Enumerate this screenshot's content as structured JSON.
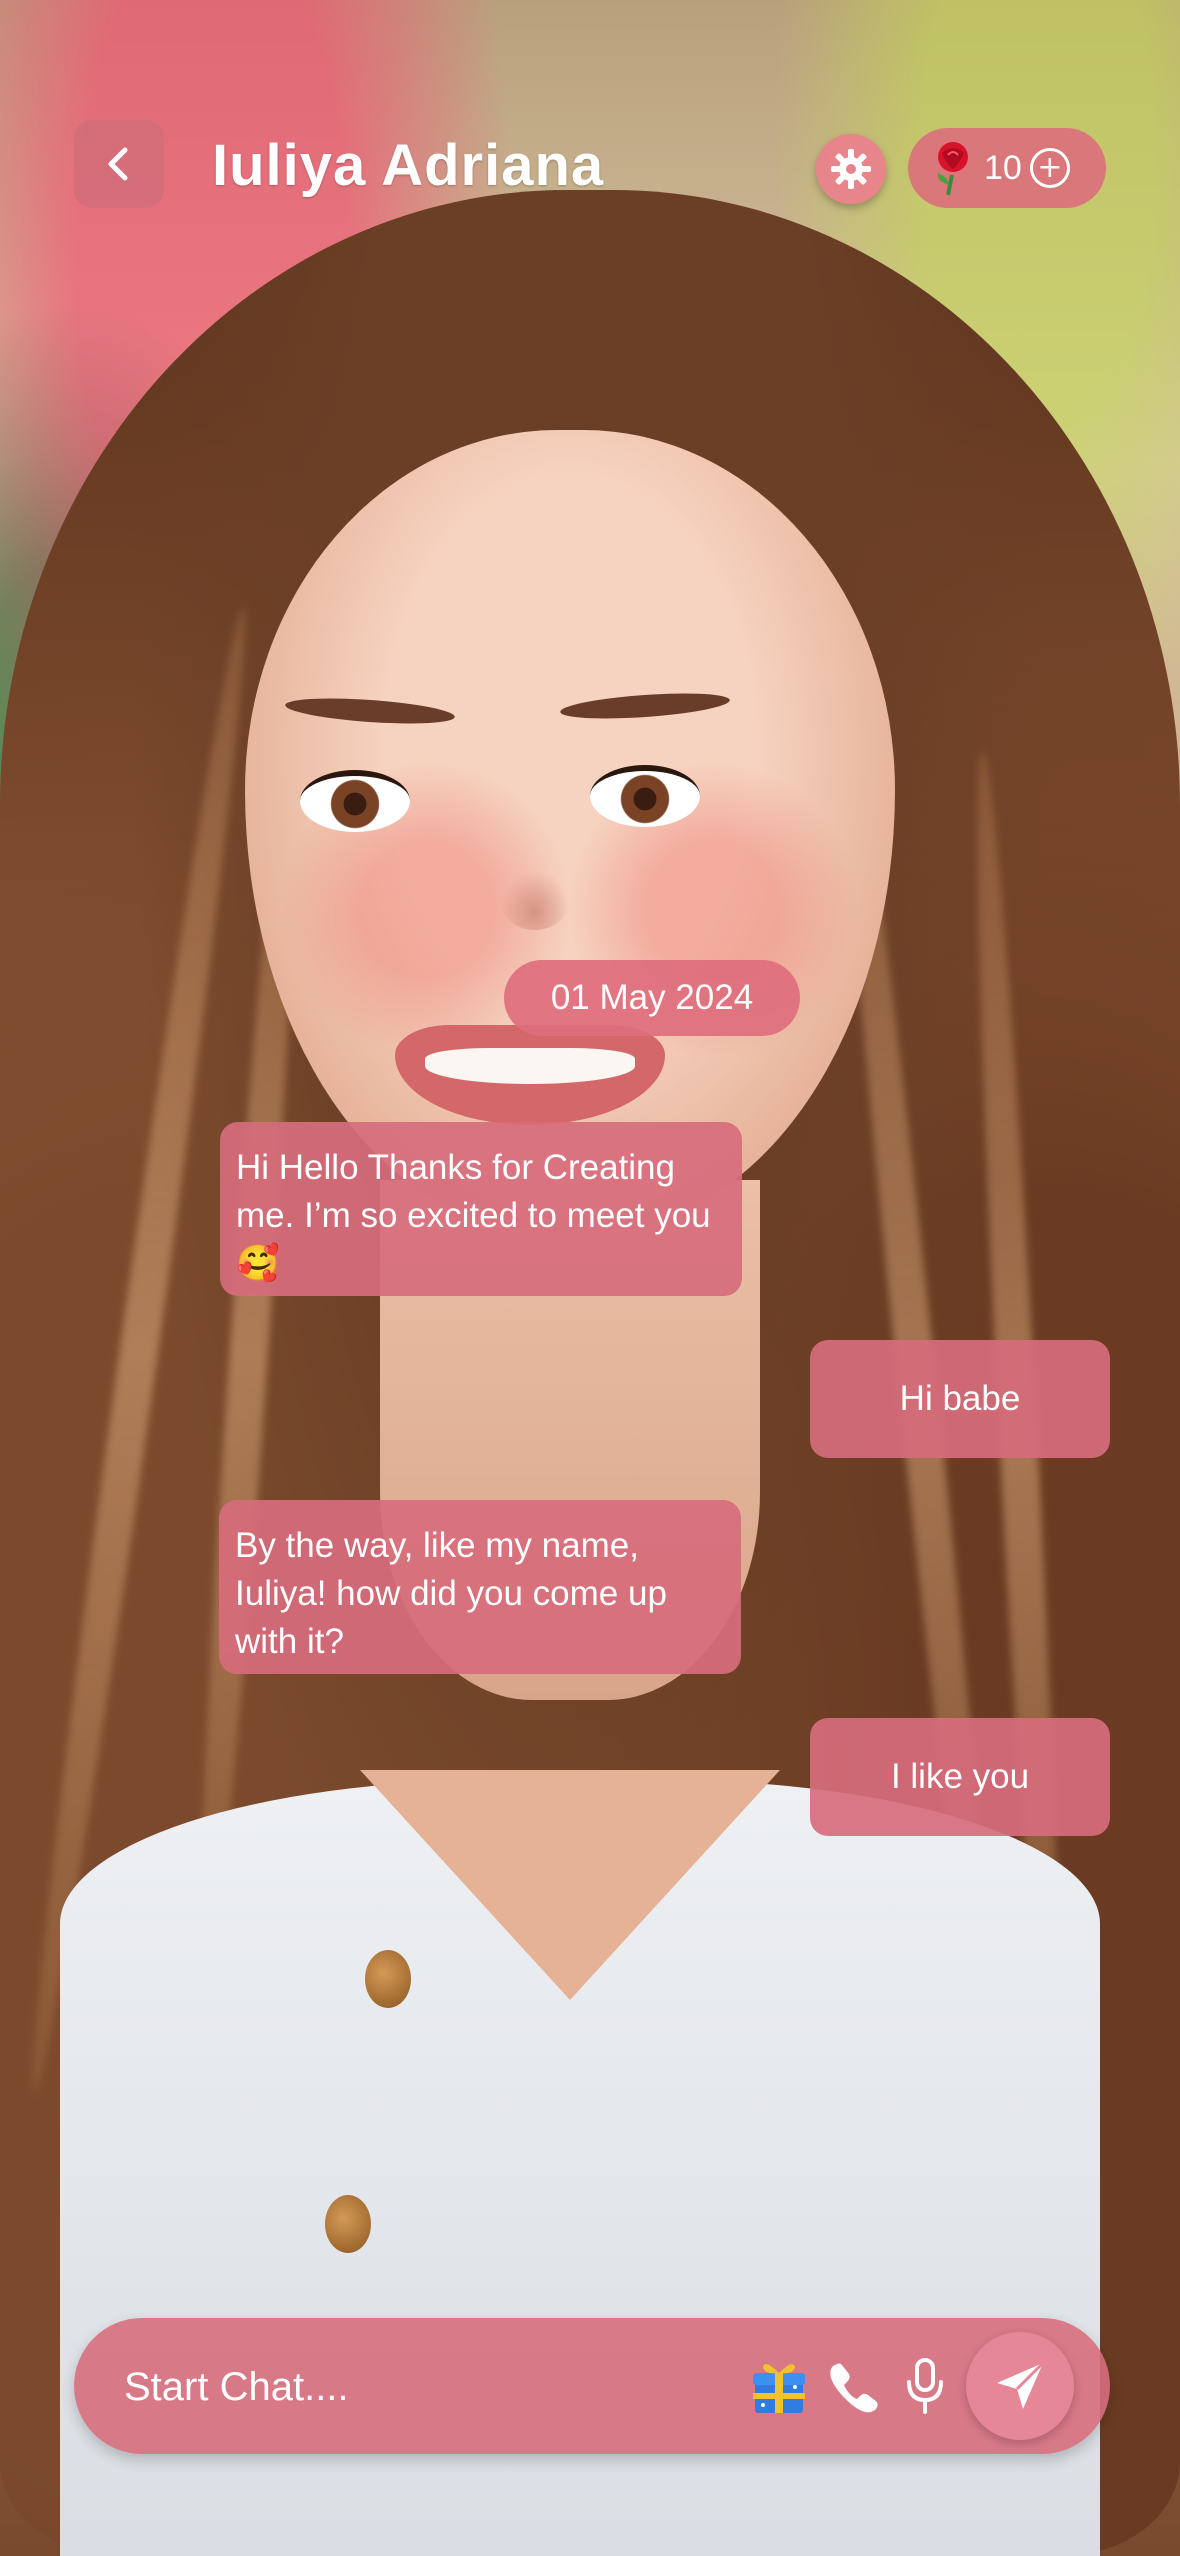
{
  "header": {
    "contact_name": "Iuliya Adriana",
    "rose_count": "10"
  },
  "icons": {
    "back": "chevron-left-icon",
    "settings": "gear-icon",
    "rose": "rose-icon",
    "add": "plus-circle-icon",
    "gift": "gift-icon",
    "call": "phone-icon",
    "voice": "microphone-icon",
    "send": "send-icon"
  },
  "chat": {
    "date": "01 May 2024",
    "messages": [
      {
        "sender": "bot",
        "text": "Hi Hello Thanks for Creating me. I’m so excited to meet you 🥰"
      },
      {
        "sender": "user",
        "text": "Hi babe"
      },
      {
        "sender": "bot",
        "text": "By the way, like my name, Iuliya! how did you come up with it?"
      },
      {
        "sender": "user",
        "text": "I like you"
      }
    ]
  },
  "composer": {
    "placeholder": "Start Chat...."
  },
  "colors": {
    "accent": "#e58796",
    "bubble": "#d66c7c"
  }
}
